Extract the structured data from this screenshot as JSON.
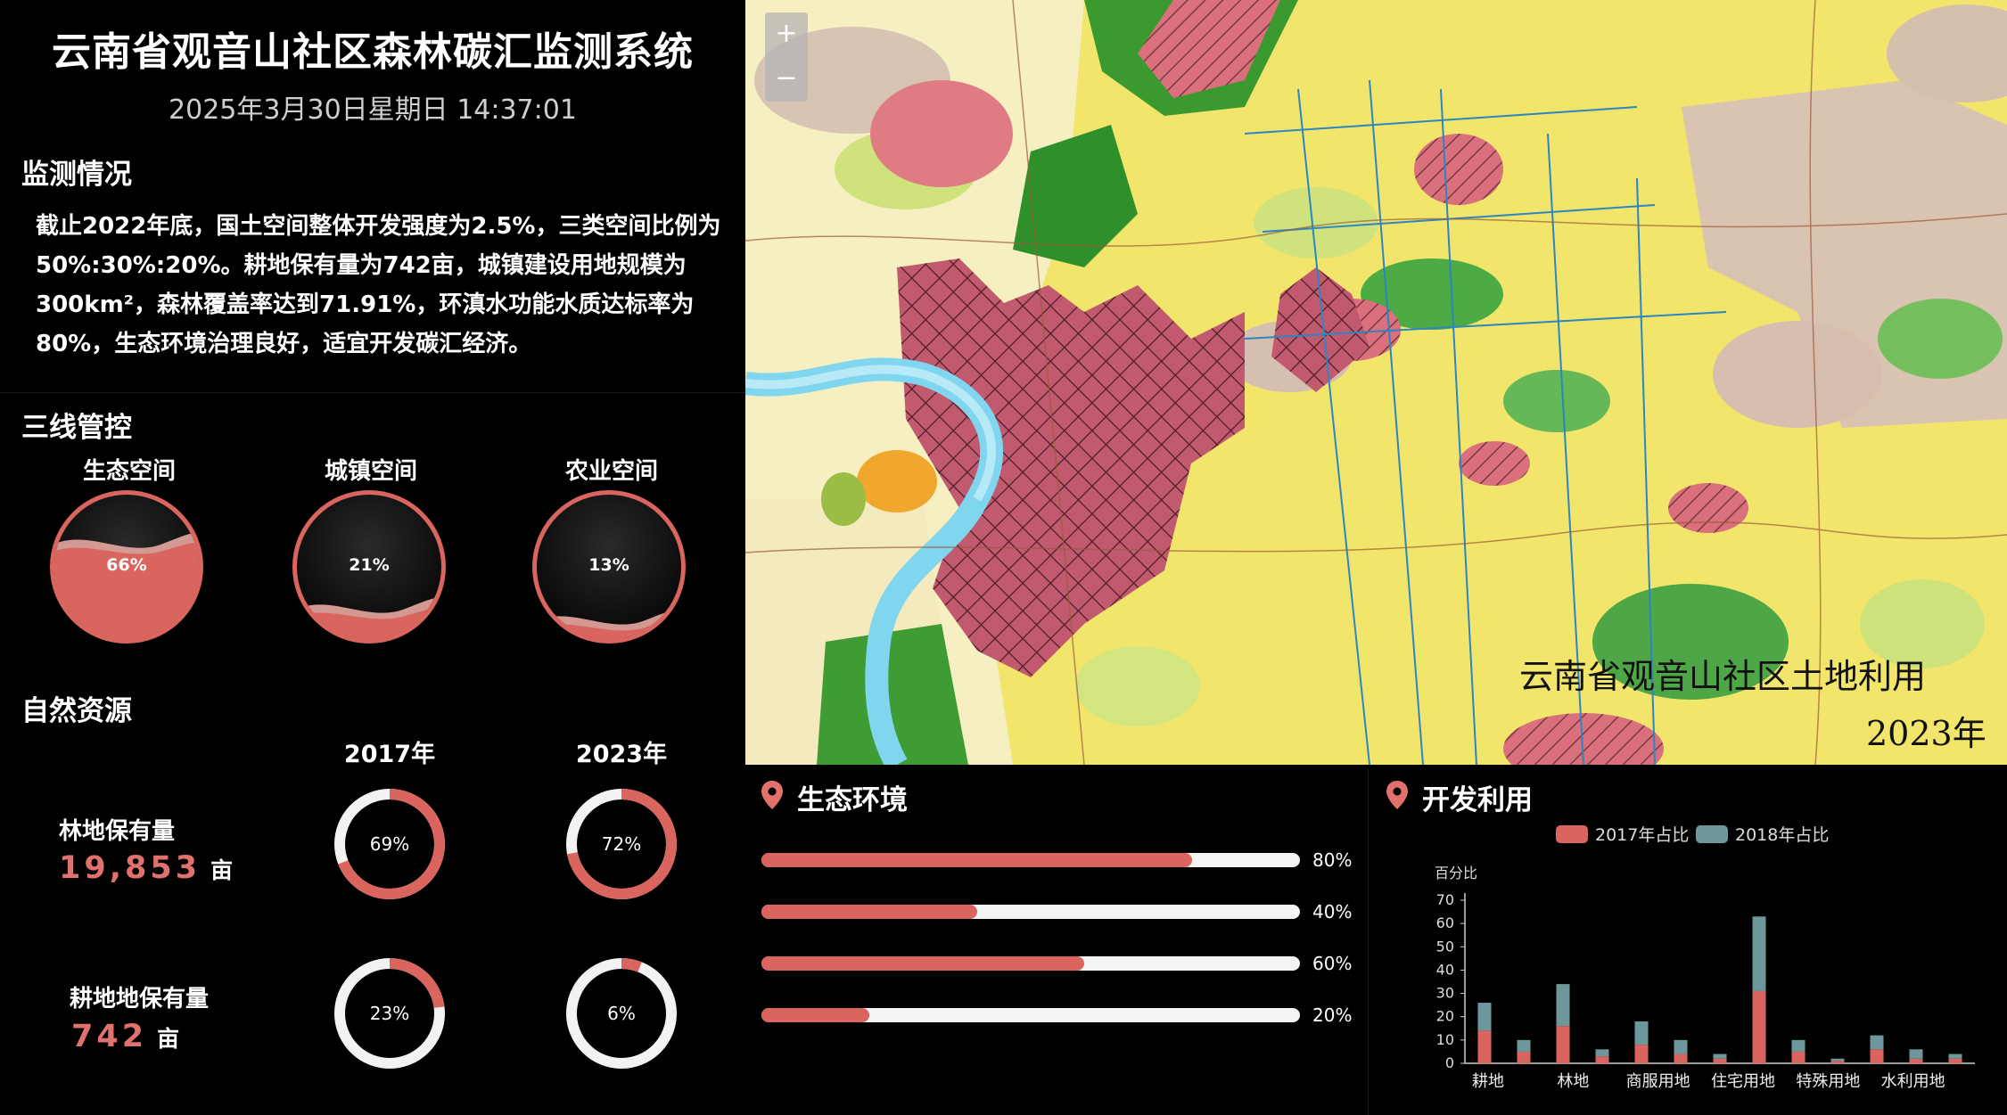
{
  "header": {
    "title": "云南省观音山社区森林碳汇监测系统",
    "datetime": "2025年3月30日星期日 14:37:01"
  },
  "monitoring": {
    "heading": "监测情况",
    "text_lines": [
      "截止2022年底，国土空间整体开发强度为2.5%，三类空间比例为",
      "50%:30%:20%。耕地保有量为742亩，城镇建设用地规模为",
      "300km²，森林覆盖率达到71.91%，环滇水功能水质达标率为",
      "80%，生态环境治理良好，适宜开发碳汇经济。"
    ]
  },
  "three_lines": {
    "heading": "三线管控",
    "items": [
      {
        "label": "生态空间",
        "percent": "66%",
        "level": 0.66
      },
      {
        "label": "城镇空间",
        "percent": "21%",
        "level": 0.21
      },
      {
        "label": "农业空间",
        "percent": "13%",
        "level": 0.13
      }
    ]
  },
  "natural_resources": {
    "heading": "自然资源",
    "years": [
      "2017年",
      "2023年"
    ],
    "rows": [
      {
        "label": "林地保有量",
        "value": "19,853",
        "unit": "亩",
        "pct_2017": "69%",
        "frac_2017": 0.69,
        "pct_2023": "72%",
        "frac_2023": 0.72
      },
      {
        "label": "耕地地保有量",
        "value": "742",
        "unit": "亩",
        "pct_2017": "23%",
        "frac_2017": 0.23,
        "pct_2023": "6%",
        "frac_2023": 0.06
      }
    ]
  },
  "map": {
    "zoom_in": "+",
    "zoom_out": "−",
    "caption_line1": "云南省观音山社区土地利用",
    "caption_line2": "2023年"
  },
  "ecology": {
    "heading": "生态环境",
    "bars": [
      {
        "label": "80%",
        "value": 0.8
      },
      {
        "label": "40%",
        "value": 0.4
      },
      {
        "label": "60%",
        "value": 0.6
      },
      {
        "label": "20%",
        "value": 0.2
      }
    ]
  },
  "development": {
    "heading": "开发利用",
    "colors": {
      "s2017": "#d9655e",
      "s2018": "#6e979c"
    },
    "chart_data": {
      "type": "bar",
      "stacked": true,
      "ylabel": "百分比",
      "ylim": [
        0,
        70
      ],
      "yticks": [
        0,
        10,
        20,
        30,
        40,
        50,
        60,
        70
      ],
      "categories": [
        "耕地",
        "",
        "林地",
        "",
        "商服用地",
        "",
        "住宅用地",
        "",
        "特殊用地",
        "",
        "水利用地",
        ""
      ],
      "category_labels_shown": [
        "耕地",
        "林地",
        "商服用地",
        "住宅用地",
        "特殊用地",
        "水利用地"
      ],
      "series": [
        {
          "name": "2017年占比",
          "values": [
            14,
            5,
            16,
            3,
            8,
            4,
            2,
            31,
            5,
            1,
            6,
            2,
            2
          ]
        },
        {
          "name": "2018年占比",
          "values": [
            12,
            5,
            18,
            3,
            10,
            6,
            2,
            32,
            5,
            1,
            6,
            4,
            2
          ]
        }
      ],
      "legend_position": "top"
    }
  }
}
